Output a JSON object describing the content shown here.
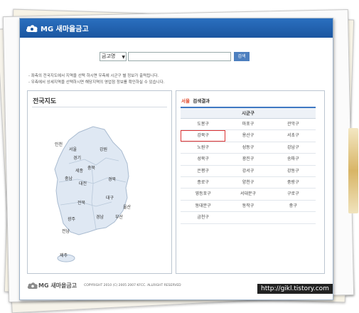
{
  "header": {
    "logo_text": "MG 새마을금고"
  },
  "search": {
    "select_value": "금고명",
    "button_label": "검색"
  },
  "notes": [
    "- 좌측의 전국지도에서 지역을 선택 하시면 우측에 시군구 별 정보가 출력됩니다.",
    "- 우측에서 상세지역을 선택하시면 해당지역의 영업점 정보를 확인하실 수 있습니다."
  ],
  "left_panel": {
    "title": "전국지도"
  },
  "map_labels": {
    "incheon": "인천",
    "seoul": "서울",
    "gyeonggi": "경기",
    "gangwon": "강원",
    "sejong": "세종",
    "chungbuk": "충북",
    "chungnam": "충남",
    "daejeon": "대전",
    "gyeongbuk": "경북",
    "jeonbuk": "전북",
    "daegu": "대구",
    "ulsan": "울산",
    "gyeongnam": "경남",
    "busan": "부산",
    "gwangju": "광주",
    "jeonnam": "전남",
    "jeju": "제주"
  },
  "right_panel": {
    "region": "서울",
    "title_suffix": "검색결과",
    "column_header": "시군구",
    "rows": [
      [
        "도봉구",
        "마포구",
        "관악구"
      ],
      [
        "강북구",
        "용산구",
        "서초구"
      ],
      [
        "노원구",
        "성동구",
        "강남구"
      ],
      [
        "성북구",
        "광진구",
        "송파구"
      ],
      [
        "은평구",
        "강서구",
        "강동구"
      ],
      [
        "종로구",
        "양천구",
        "중랑구"
      ],
      [
        "영등포구",
        "서대문구",
        "구로구"
      ],
      [
        "동대문구",
        "동작구",
        "중구"
      ],
      [
        "금천구",
        "",
        ""
      ]
    ]
  },
  "footer": {
    "logo_text": "MG 새마을금고",
    "copyright": "COPYRIGHT 2010 (C) 2005 2007 KFCC. ALLRIGHT RESERVED"
  },
  "watermark": {
    "url": "http://gikl.tistory.com"
  }
}
